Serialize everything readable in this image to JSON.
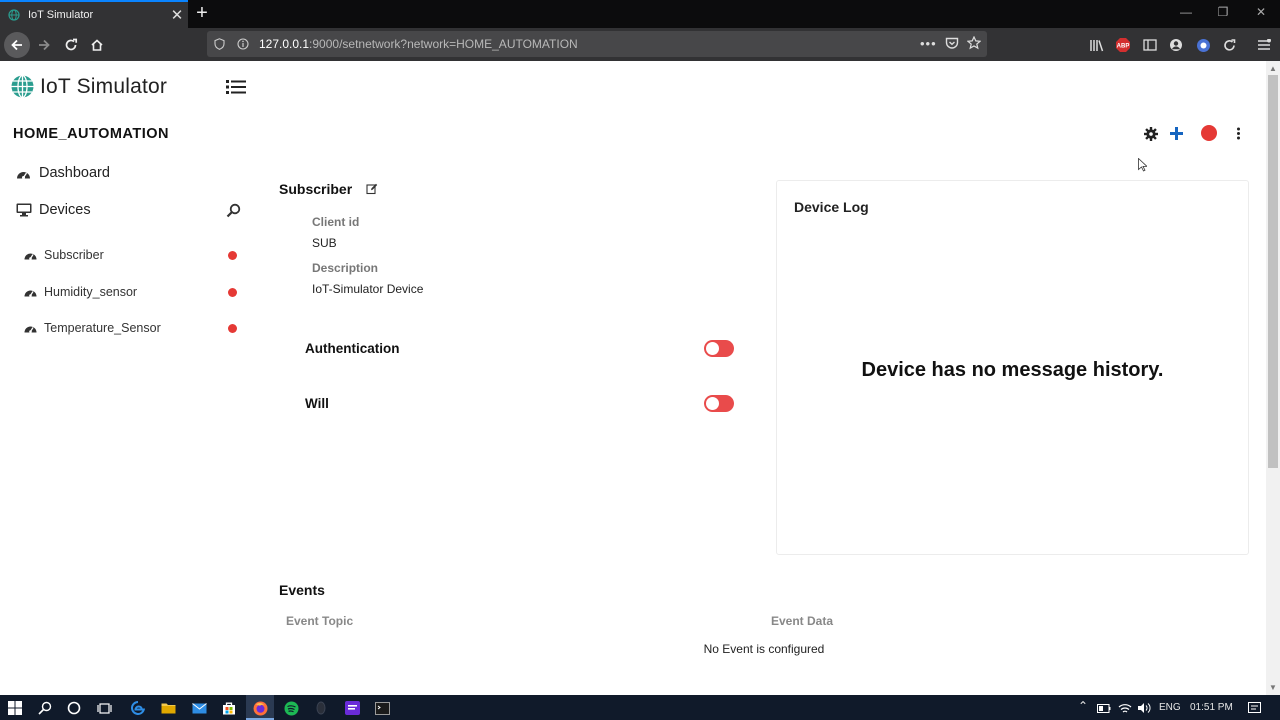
{
  "browser": {
    "tab_title": "IoT Simulator",
    "url_host": "127.0.0.1",
    "url_path": ":9000/setnetwork?network=HOME_AUTOMATION"
  },
  "app": {
    "title": "IoT Simulator",
    "network_name": "HOME_AUTOMATION",
    "accent_color": "#e53935"
  },
  "sidebar": {
    "dashboard_label": "Dashboard",
    "devices_label": "Devices",
    "devices": [
      {
        "name": "Subscriber",
        "status_color": "#e53935"
      },
      {
        "name": "Humidity_sensor",
        "status_color": "#e53935"
      },
      {
        "name": "Temperature_Sensor",
        "status_color": "#e53935"
      }
    ]
  },
  "device": {
    "name": "Subscriber",
    "client_id_label": "Client id",
    "client_id": "SUB",
    "description_label": "Description",
    "description": "IoT-Simulator Device",
    "authentication_label": "Authentication",
    "authentication_enabled": false,
    "will_label": "Will",
    "will_enabled": false
  },
  "device_log": {
    "title": "Device Log",
    "empty_message": "Device has no message history."
  },
  "events": {
    "title": "Events",
    "col_topic": "Event Topic",
    "col_data": "Event Data",
    "empty_message": "No Event is configured"
  },
  "taskbar": {
    "language": "ENG",
    "time": "01:51 PM"
  }
}
